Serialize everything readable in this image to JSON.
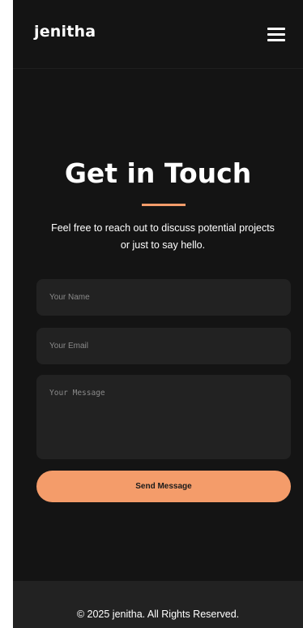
{
  "header": {
    "brand": "jenitha",
    "menu_icon": "hamburger-menu-icon"
  },
  "contact": {
    "title": "Get in Touch",
    "subtitle": "Feel free to reach out to discuss potential projects or just to say hello.",
    "name_placeholder": "Your Name",
    "email_placeholder": "Your Email",
    "message_placeholder": "Your Message",
    "send_label": "Send Message"
  },
  "footer": {
    "copyright": "© 2025 jenitha. All Rights Reserved."
  },
  "colors": {
    "background": "#141414",
    "accent": "#f49c6a",
    "field": "#222222",
    "footer": "#222222"
  }
}
